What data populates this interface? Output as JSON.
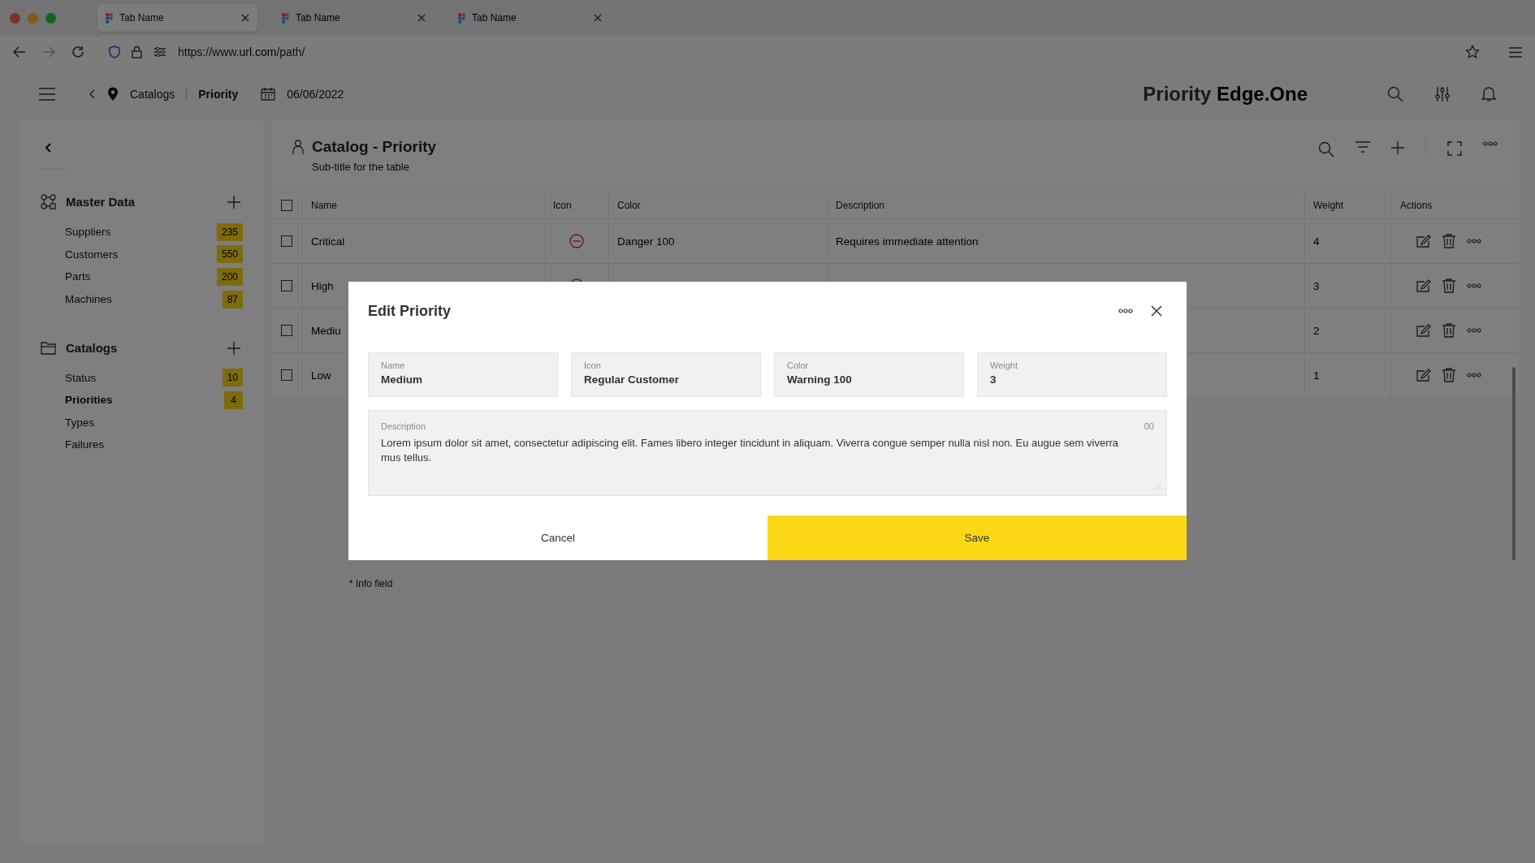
{
  "browser": {
    "tabs": [
      {
        "title": "Tab Name",
        "selected": true
      },
      {
        "title": "Tab Name",
        "selected": false
      },
      {
        "title": "Tab Name",
        "selected": false
      }
    ],
    "url": {
      "prefix": "https://www.",
      "domain": "url.com",
      "path": "/path/"
    }
  },
  "header": {
    "breadcrumb": [
      {
        "label": "Catalogs",
        "current": false
      },
      {
        "label": "Priority",
        "current": true
      }
    ],
    "date": "06/06/2022",
    "logo": {
      "first": "Priority",
      "second": "Edge.One"
    }
  },
  "sidebar": {
    "sections": [
      {
        "title": "Master Data",
        "kind": "network",
        "items": [
          {
            "label": "Suppliers",
            "count": "235",
            "selected": false
          },
          {
            "label": "Customers",
            "count": "550",
            "selected": false
          },
          {
            "label": "Parts",
            "count": "200",
            "selected": false
          },
          {
            "label": "Machines",
            "count": "87",
            "selected": false
          }
        ]
      },
      {
        "title": "Catalogs",
        "kind": "folder",
        "items": [
          {
            "label": "Status",
            "count": "10",
            "selected": false
          },
          {
            "label": "Priorities",
            "count": "4",
            "selected": true
          },
          {
            "label": "Types",
            "selected": false
          },
          {
            "label": "Failures",
            "selected": false
          }
        ]
      }
    ]
  },
  "table": {
    "title": "Catalog - Priority",
    "subtitle": "Sub-title for the table",
    "columns": [
      "Name",
      "Icon",
      "Color",
      "Description",
      "Weight",
      "Actions"
    ],
    "all_checked": false,
    "rows": [
      {
        "name": "Critical",
        "color_name": "Danger 100",
        "description": "Requires immediate attention",
        "weight": "4",
        "checked": false
      },
      {
        "name": "High",
        "weight": "3",
        "checked": false
      },
      {
        "name": "Mediu",
        "weight": "2",
        "checked": false
      },
      {
        "name": "Low",
        "weight": "1",
        "checked": false
      }
    ],
    "footnote": "* Info field"
  },
  "dialog": {
    "title": "Edit Priority",
    "fields": [
      {
        "label": "Name",
        "value": "Medium"
      },
      {
        "label": "Icon",
        "value": "Regular Customer"
      },
      {
        "label": "Color",
        "value": "Warning 100"
      },
      {
        "label": "Weight",
        "value": "3"
      }
    ],
    "description": {
      "label": "Description",
      "value": "Lorem ipsum dolor sit amet, consectetur adipiscing elit. Fames libero integer tincidunt in aliquam. Viverra congue semper nulla nisl non. Eu augue sem viverra mus tellus.",
      "counter": "00"
    },
    "buttons": [
      {
        "label": "Cancel",
        "kind": "secondary"
      },
      {
        "label": "Save",
        "kind": "primary"
      }
    ]
  }
}
